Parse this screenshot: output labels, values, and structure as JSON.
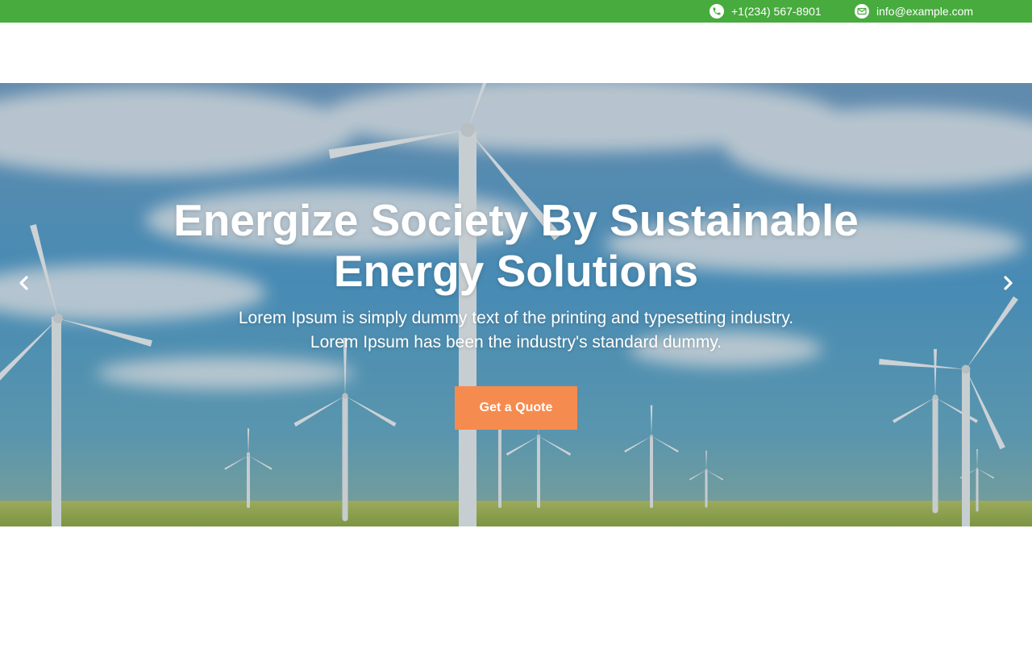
{
  "topbar": {
    "phone": {
      "icon": "phone-icon",
      "text": "+1(234) 567-8901"
    },
    "email": {
      "icon": "mail-icon",
      "text": "info@example.com"
    },
    "background": "#47ab3d"
  },
  "hero": {
    "title": "Energize Society By Sustainable Energy Solutions",
    "subtitle_line1": "Lorem Ipsum is simply dummy text of the printing and typesetting industry.",
    "subtitle_line2": "Lorem Ipsum has been the industry's standard dummy.",
    "cta_label": "Get a Quote",
    "cta_color": "#f68b4f",
    "prev_icon": "chevron-left-icon",
    "next_icon": "chevron-right-icon",
    "background_image": "wind-turbines-field"
  }
}
